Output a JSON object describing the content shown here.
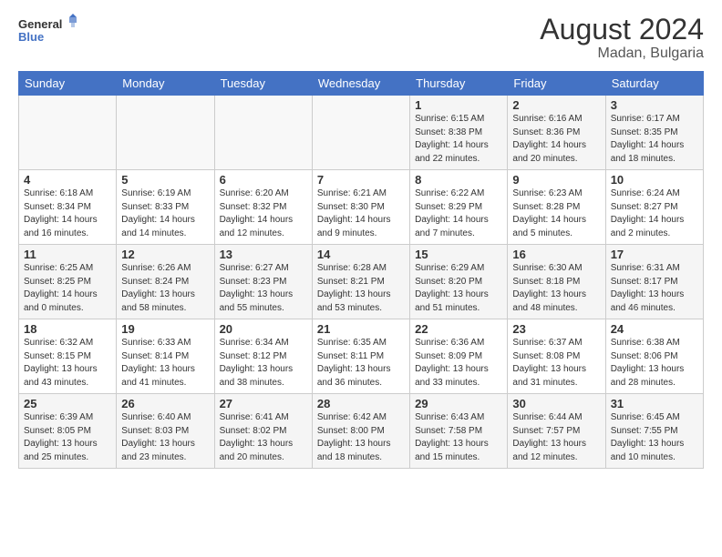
{
  "header": {
    "logo_general": "General",
    "logo_blue": "Blue",
    "month_year": "August 2024",
    "location": "Madan, Bulgaria"
  },
  "weekdays": [
    "Sunday",
    "Monday",
    "Tuesday",
    "Wednesday",
    "Thursday",
    "Friday",
    "Saturday"
  ],
  "weeks": [
    [
      {
        "day": "",
        "info": ""
      },
      {
        "day": "",
        "info": ""
      },
      {
        "day": "",
        "info": ""
      },
      {
        "day": "",
        "info": ""
      },
      {
        "day": "1",
        "info": "Sunrise: 6:15 AM\nSunset: 8:38 PM\nDaylight: 14 hours\nand 22 minutes."
      },
      {
        "day": "2",
        "info": "Sunrise: 6:16 AM\nSunset: 8:36 PM\nDaylight: 14 hours\nand 20 minutes."
      },
      {
        "day": "3",
        "info": "Sunrise: 6:17 AM\nSunset: 8:35 PM\nDaylight: 14 hours\nand 18 minutes."
      }
    ],
    [
      {
        "day": "4",
        "info": "Sunrise: 6:18 AM\nSunset: 8:34 PM\nDaylight: 14 hours\nand 16 minutes."
      },
      {
        "day": "5",
        "info": "Sunrise: 6:19 AM\nSunset: 8:33 PM\nDaylight: 14 hours\nand 14 minutes."
      },
      {
        "day": "6",
        "info": "Sunrise: 6:20 AM\nSunset: 8:32 PM\nDaylight: 14 hours\nand 12 minutes."
      },
      {
        "day": "7",
        "info": "Sunrise: 6:21 AM\nSunset: 8:30 PM\nDaylight: 14 hours\nand 9 minutes."
      },
      {
        "day": "8",
        "info": "Sunrise: 6:22 AM\nSunset: 8:29 PM\nDaylight: 14 hours\nand 7 minutes."
      },
      {
        "day": "9",
        "info": "Sunrise: 6:23 AM\nSunset: 8:28 PM\nDaylight: 14 hours\nand 5 minutes."
      },
      {
        "day": "10",
        "info": "Sunrise: 6:24 AM\nSunset: 8:27 PM\nDaylight: 14 hours\nand 2 minutes."
      }
    ],
    [
      {
        "day": "11",
        "info": "Sunrise: 6:25 AM\nSunset: 8:25 PM\nDaylight: 14 hours\nand 0 minutes."
      },
      {
        "day": "12",
        "info": "Sunrise: 6:26 AM\nSunset: 8:24 PM\nDaylight: 13 hours\nand 58 minutes."
      },
      {
        "day": "13",
        "info": "Sunrise: 6:27 AM\nSunset: 8:23 PM\nDaylight: 13 hours\nand 55 minutes."
      },
      {
        "day": "14",
        "info": "Sunrise: 6:28 AM\nSunset: 8:21 PM\nDaylight: 13 hours\nand 53 minutes."
      },
      {
        "day": "15",
        "info": "Sunrise: 6:29 AM\nSunset: 8:20 PM\nDaylight: 13 hours\nand 51 minutes."
      },
      {
        "day": "16",
        "info": "Sunrise: 6:30 AM\nSunset: 8:18 PM\nDaylight: 13 hours\nand 48 minutes."
      },
      {
        "day": "17",
        "info": "Sunrise: 6:31 AM\nSunset: 8:17 PM\nDaylight: 13 hours\nand 46 minutes."
      }
    ],
    [
      {
        "day": "18",
        "info": "Sunrise: 6:32 AM\nSunset: 8:15 PM\nDaylight: 13 hours\nand 43 minutes."
      },
      {
        "day": "19",
        "info": "Sunrise: 6:33 AM\nSunset: 8:14 PM\nDaylight: 13 hours\nand 41 minutes."
      },
      {
        "day": "20",
        "info": "Sunrise: 6:34 AM\nSunset: 8:12 PM\nDaylight: 13 hours\nand 38 minutes."
      },
      {
        "day": "21",
        "info": "Sunrise: 6:35 AM\nSunset: 8:11 PM\nDaylight: 13 hours\nand 36 minutes."
      },
      {
        "day": "22",
        "info": "Sunrise: 6:36 AM\nSunset: 8:09 PM\nDaylight: 13 hours\nand 33 minutes."
      },
      {
        "day": "23",
        "info": "Sunrise: 6:37 AM\nSunset: 8:08 PM\nDaylight: 13 hours\nand 31 minutes."
      },
      {
        "day": "24",
        "info": "Sunrise: 6:38 AM\nSunset: 8:06 PM\nDaylight: 13 hours\nand 28 minutes."
      }
    ],
    [
      {
        "day": "25",
        "info": "Sunrise: 6:39 AM\nSunset: 8:05 PM\nDaylight: 13 hours\nand 25 minutes."
      },
      {
        "day": "26",
        "info": "Sunrise: 6:40 AM\nSunset: 8:03 PM\nDaylight: 13 hours\nand 23 minutes."
      },
      {
        "day": "27",
        "info": "Sunrise: 6:41 AM\nSunset: 8:02 PM\nDaylight: 13 hours\nand 20 minutes."
      },
      {
        "day": "28",
        "info": "Sunrise: 6:42 AM\nSunset: 8:00 PM\nDaylight: 13 hours\nand 18 minutes."
      },
      {
        "day": "29",
        "info": "Sunrise: 6:43 AM\nSunset: 7:58 PM\nDaylight: 13 hours\nand 15 minutes."
      },
      {
        "day": "30",
        "info": "Sunrise: 6:44 AM\nSunset: 7:57 PM\nDaylight: 13 hours\nand 12 minutes."
      },
      {
        "day": "31",
        "info": "Sunrise: 6:45 AM\nSunset: 7:55 PM\nDaylight: 13 hours\nand 10 minutes."
      }
    ]
  ]
}
